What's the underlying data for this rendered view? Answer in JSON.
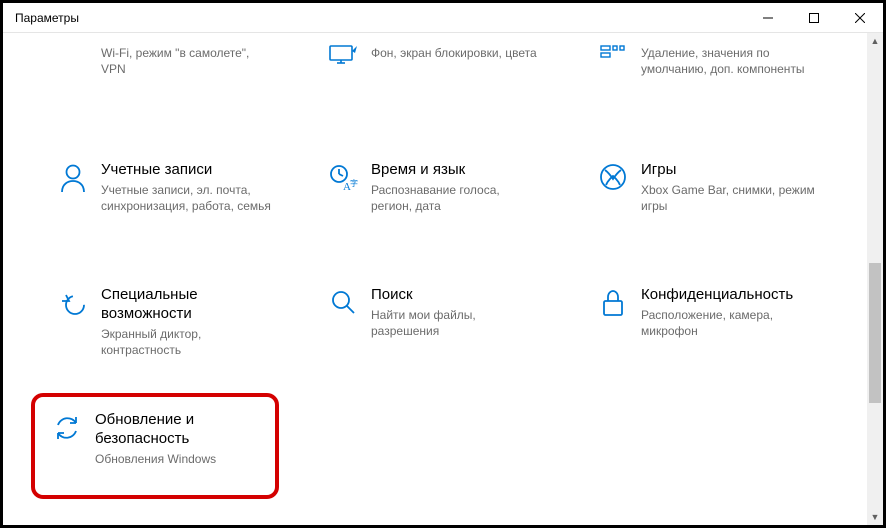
{
  "window": {
    "title": "Параметры"
  },
  "tiles": {
    "network": {
      "desc": "Wi-Fi, режим \"в самолете\", VPN"
    },
    "personalization": {
      "desc": "Фон, экран блокировки, цвета"
    },
    "apps": {
      "desc": "Удаление, значения по умолчанию, доп. компоненты"
    },
    "accounts": {
      "title": "Учетные записи",
      "desc": "Учетные записи, эл. почта, синхронизация, работа, семья"
    },
    "time": {
      "title": "Время и язык",
      "desc": "Распознавание голоса, регион, дата"
    },
    "gaming": {
      "title": "Игры",
      "desc": "Xbox Game Bar, снимки, режим игры"
    },
    "ease": {
      "title": "Специальные возможности",
      "desc": "Экранный диктор, контрастность"
    },
    "search": {
      "title": "Поиск",
      "desc": "Найти мои файлы, разрешения"
    },
    "privacy": {
      "title": "Конфиденциальность",
      "desc": "Расположение, камера, микрофон"
    },
    "update": {
      "title": "Обновление и безопасность",
      "desc": "Обновления Windows"
    }
  }
}
